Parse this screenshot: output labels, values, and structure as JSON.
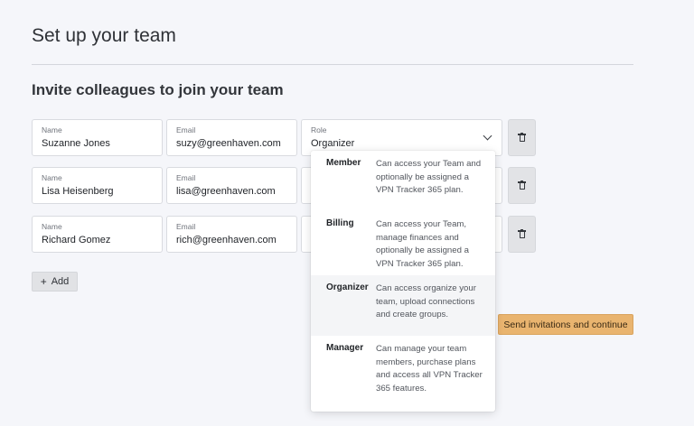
{
  "page": {
    "title": "Set up your team",
    "section_title": "Invite colleagues to join your team"
  },
  "labels": {
    "name": "Name",
    "email": "Email",
    "role": "Role"
  },
  "rows": [
    {
      "name": "Suzanne Jones",
      "email": "suzy@greenhaven.com",
      "role": "Organizer"
    },
    {
      "name": "Lisa Heisenberg",
      "email": "lisa@greenhaven.com",
      "role": ""
    },
    {
      "name": "Richard Gomez",
      "email": "rich@greenhaven.com",
      "role": ""
    }
  ],
  "buttons": {
    "add_plus": "+",
    "add_label": "Add",
    "send_label": "Send invitations and continue"
  },
  "role_options": [
    {
      "name": "Member",
      "description": "Can access your Team and optionally be assigned a VPN Tracker 365 plan.",
      "selected": false
    },
    {
      "name": "Billing",
      "description": "Can access your Team, manage finances and optionally be assigned a VPN Tracker 365 plan.",
      "selected": false
    },
    {
      "name": "Organizer",
      "description": "Can access organize your team, upload connections and create groups.",
      "selected": true
    },
    {
      "name": "Manager",
      "description": "Can manage your team members, purchase plans and access all VPN Tracker 365 features.",
      "selected": false
    }
  ],
  "icons": {
    "delete": "trash-icon",
    "role_select": "chevron-down-icon"
  },
  "colors": {
    "primary_button": "#e9b46f",
    "background": "#f5f6fa"
  }
}
